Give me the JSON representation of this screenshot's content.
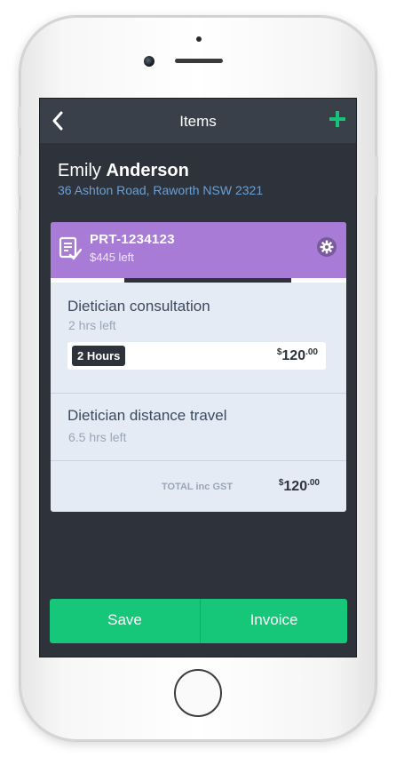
{
  "nav": {
    "title": "Items",
    "back_icon": "chevron-left-icon",
    "add_icon": "plus-icon",
    "add_color": "#19c27a"
  },
  "client": {
    "first_name": "Emily",
    "last_name": "Anderson",
    "address": "36 Ashton Road, Raworth NSW 2321"
  },
  "plan": {
    "id": "PRT-1234123",
    "remaining": "$445 left",
    "color": "#a77bd6",
    "settings_icon": "gear-icon",
    "doc_icon": "document-check-icon"
  },
  "items": [
    {
      "title": "Dietician consultation",
      "remaining": "2 hrs left",
      "quantity": "2 Hours",
      "price_currency": "$",
      "price_amount": "120",
      "price_cents": ".00"
    },
    {
      "title": "Dietician distance travel",
      "remaining": "6.5 hrs left"
    }
  ],
  "total": {
    "label": "TOTAL inc GST",
    "currency": "$",
    "amount": "120",
    "cents": ".00"
  },
  "actions": {
    "save_label": "Save",
    "invoice_label": "Invoice",
    "color": "#16c679"
  }
}
